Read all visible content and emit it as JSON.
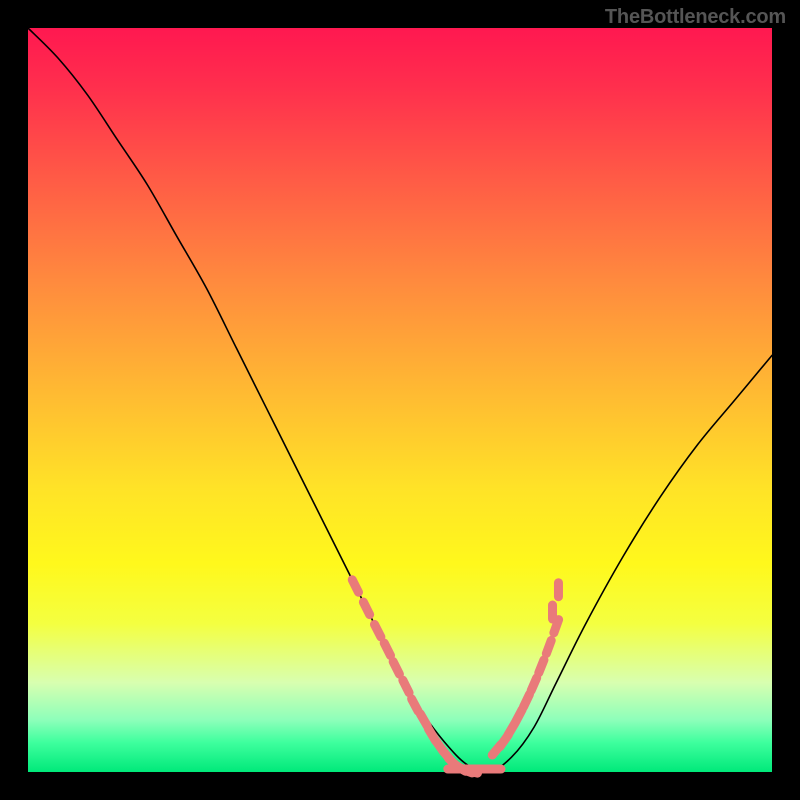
{
  "watermark": "TheBottleneck.com",
  "chart_data": {
    "type": "line",
    "title": "",
    "xlabel": "",
    "ylabel": "",
    "xlim": [
      0,
      100
    ],
    "ylim": [
      0,
      100
    ],
    "series": [
      {
        "name": "curve",
        "x": [
          0,
          4,
          8,
          12,
          16,
          20,
          24,
          28,
          32,
          36,
          40,
          44,
          47,
          50,
          53,
          56,
          59,
          62,
          65,
          68,
          71,
          75,
          80,
          85,
          90,
          95,
          100
        ],
        "y": [
          100,
          96,
          91,
          85,
          79,
          72,
          65,
          57,
          49,
          41,
          33,
          25,
          19,
          13,
          8,
          4,
          1,
          0,
          2,
          6,
          12,
          20,
          29,
          37,
          44,
          50,
          56
        ]
      }
    ],
    "markers_left": {
      "x": [
        44,
        45.5,
        47,
        48.3,
        49.5,
        50.8,
        52,
        53.2,
        54.3,
        55.3,
        56.3,
        57.2,
        58.0,
        58.8,
        59.5
      ],
      "y": [
        25,
        22,
        19,
        16.5,
        14,
        11.5,
        9,
        7,
        5,
        3.5,
        2.2,
        1.2,
        0.6,
        0.2,
        0.05
      ]
    },
    "markers_right": {
      "x": [
        63,
        64,
        65,
        66,
        67,
        68,
        69,
        70,
        71
      ],
      "y": [
        3.0,
        4.2,
        5.8,
        7.6,
        9.6,
        11.8,
        14.2,
        16.8,
        19.6
      ]
    },
    "marker_extras": {
      "x": [
        70.5,
        71.3
      ],
      "y": [
        21.5,
        24.5
      ]
    }
  }
}
